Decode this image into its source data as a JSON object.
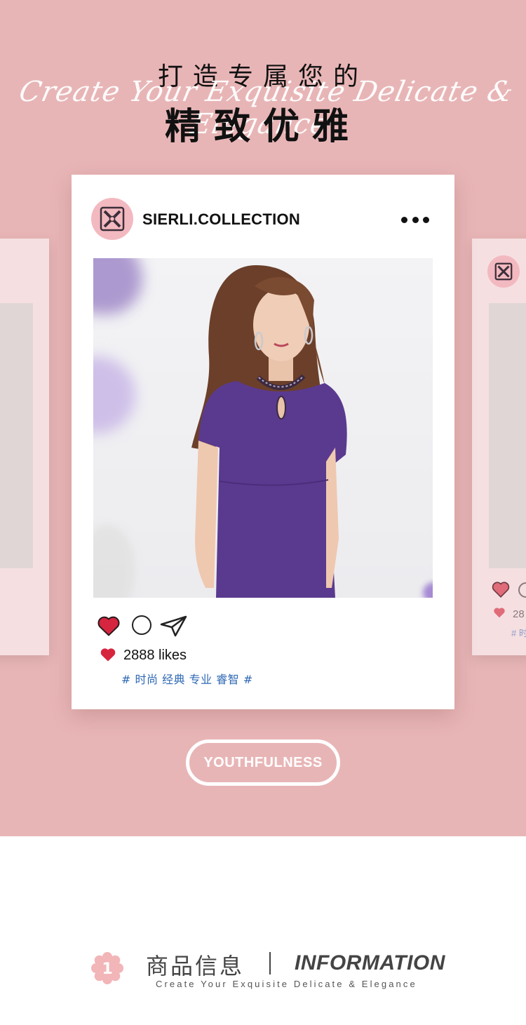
{
  "hero": {
    "title_line1": "打造专属您的",
    "script_text": "Create Your Exquisite Delicate & Elegance",
    "title_line2": "精致优雅",
    "background_color": "#e8b5b6"
  },
  "post": {
    "username": "SIERLI.COLLECTION",
    "avatar_icon": "brand-logo-icon",
    "more_icon": "more-dots-icon",
    "photo_alt": "model in purple dress",
    "actions": {
      "like_icon": "heart-icon",
      "comment_icon": "comment-icon",
      "share_icon": "send-icon"
    },
    "likes": "2888 likes",
    "tags": "# 时尚 经典 专业 睿智 #",
    "tag_color": "#2f68b4",
    "heart_color": "#d6253f"
  },
  "side_right": {
    "likes_partial": "28",
    "tag_partial": "# 时"
  },
  "cta": {
    "label": "YOUTHFULNESS"
  },
  "info": {
    "badge_number": "1",
    "title_cn": "商品信息",
    "title_en": "INFORMATION",
    "subtitle": "Create Your Exquisite Delicate & Elegance"
  }
}
